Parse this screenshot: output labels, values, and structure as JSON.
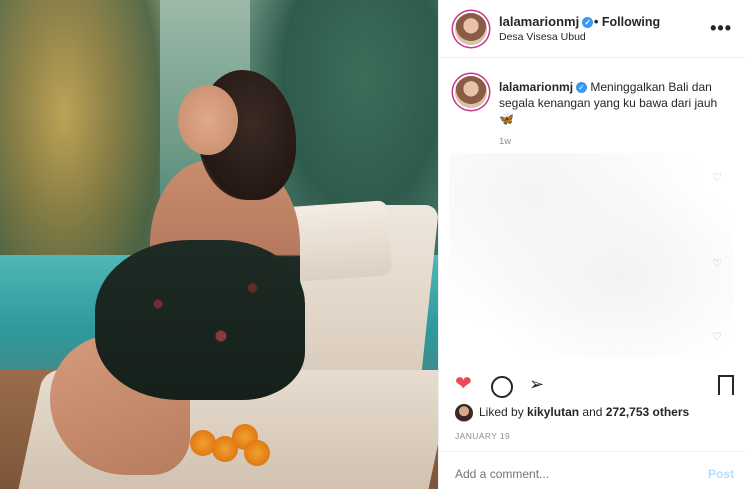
{
  "post": {
    "photo_alt": "",
    "username": "lalamarionmj",
    "follow_label": "• Following",
    "location": "Desa Visesa Ubud",
    "more_label": "•••",
    "verified_mark": "✓"
  },
  "caption": {
    "username": "lalamarionmj",
    "text": "Meninggalkan Bali dan segala kenangan yang ku bawa dari jauh 🦋",
    "time": "1w"
  },
  "comment_hearts": [
    "♡",
    "♡",
    "♡"
  ],
  "actions": {
    "like_icon": "heart-filled-icon",
    "comment_icon": "comment-icon",
    "share_icon": "share-icon",
    "save_icon": "bookmark-icon",
    "like_glyph": "❤",
    "share_glyph": "➢"
  },
  "likes": {
    "prefix": "Liked by",
    "user": "kikylutan",
    "connector": "and",
    "others": "272,753 others"
  },
  "date": "JANUARY 19",
  "comment_box": {
    "placeholder": "Add a comment...",
    "post_label": "Post"
  },
  "colors": {
    "like": "#ed4956",
    "verified": "#3897f0",
    "post_disabled": "#b2dffc"
  }
}
